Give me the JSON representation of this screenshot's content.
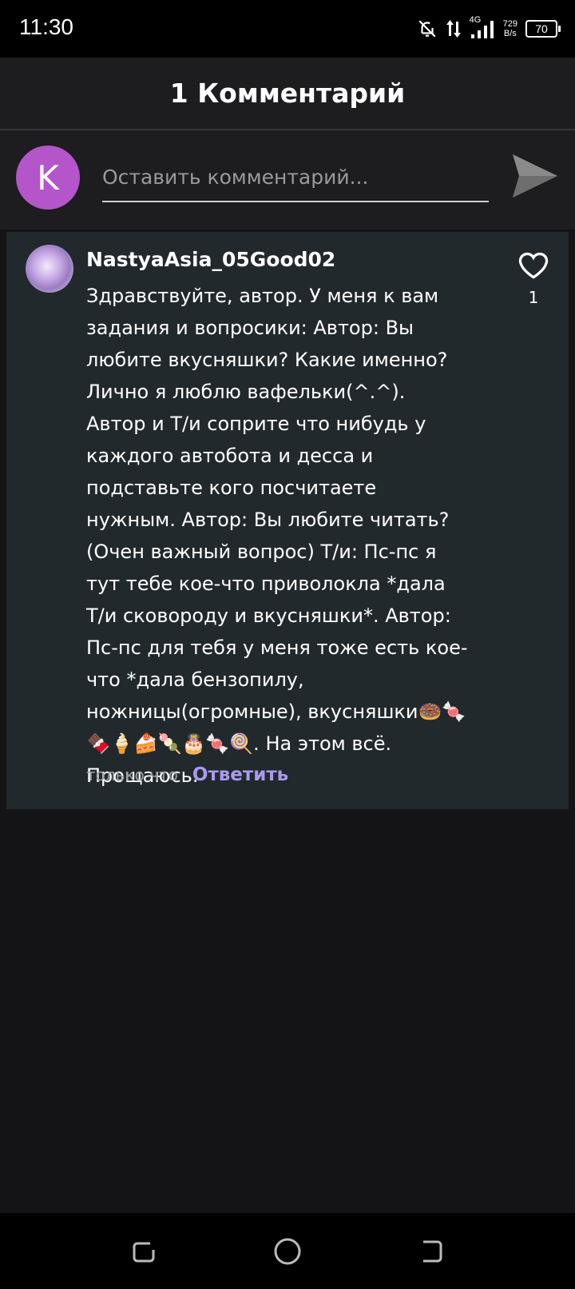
{
  "status_bar": {
    "time": "11:30",
    "network": "4G",
    "speed_value": "729",
    "speed_unit": "B/s",
    "battery": "70"
  },
  "header": {
    "title": "1 Комментарий"
  },
  "composer": {
    "avatar_letter": "K",
    "avatar_color": "#b455c9",
    "placeholder": "Оставить комментарий..."
  },
  "comments": [
    {
      "username": "NastyaAsia_05Good02",
      "text": "Здравствуйте, автор. У меня к вам задания и вопросики: Автор: Вы любите вкусняшки? Какие именно? Лично я люблю вафельки(^.^). Автор и Т/и соприте что нибудь у каждого автобота и десса и подставьте кого посчитаете нужным. Автор: Вы любите читать? (Очен важный вопрос) Т/и: Пс-пс я тут тебе кое-что приволокла *дала Т/и сковороду и вкусняшки*. Автор: Пс-пс для тебя у меня тоже есть кое-что *дала бензопилу, ножницы(огромные), вкусняшки🍩🍬🍫🍦🍰🍡🎂🍬🍭. На этом всё. Прощаюсь.",
      "time_ago": "только что",
      "reply_label": "Ответить",
      "likes": "1"
    }
  ],
  "colors": {
    "accent": "#a99af0",
    "card": "#22292c"
  }
}
